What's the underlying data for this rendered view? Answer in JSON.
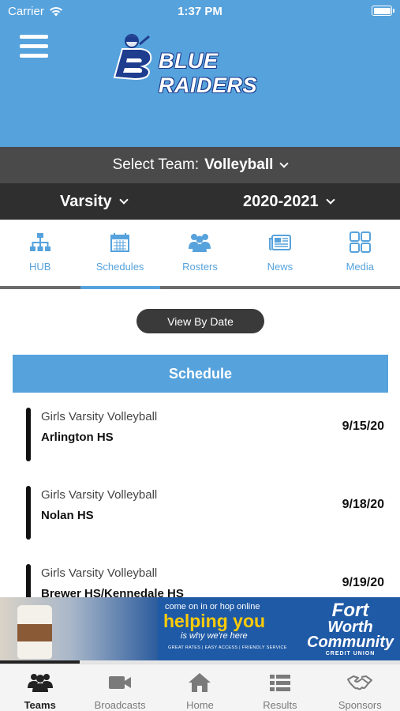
{
  "status_bar": {
    "carrier": "Carrier",
    "time": "1:37 PM"
  },
  "header": {
    "brand": "BLUE RAIDERS"
  },
  "team_selector": {
    "label": "Select Team:",
    "value": "Volleyball"
  },
  "level": {
    "value": "Varsity"
  },
  "season": {
    "value": "2020-2021"
  },
  "tabs": [
    {
      "label": "HUB",
      "icon": "org-chart-icon"
    },
    {
      "label": "Schedules",
      "icon": "calendar-icon",
      "active": true
    },
    {
      "label": "Rosters",
      "icon": "people-icon"
    },
    {
      "label": "News",
      "icon": "newspaper-icon"
    },
    {
      "label": "Media",
      "icon": "grid-icon"
    }
  ],
  "view_button": "View By Date",
  "schedule": {
    "title": "Schedule",
    "games": [
      {
        "sport": "Girls Varsity Volleyball",
        "opponent": "Arlington HS",
        "date": "9/15/20"
      },
      {
        "sport": "Girls Varsity Volleyball",
        "opponent": "Nolan HS",
        "date": "9/18/20"
      },
      {
        "sport": "Girls Varsity Volleyball",
        "opponent": "Brewer HS/Kennedale HS",
        "date": "9/19/20"
      }
    ]
  },
  "ad": {
    "line1": "come on in or hop online",
    "line2": "helping you",
    "line3": "is why we're here",
    "line4": "GREAT RATES | EASY ACCESS | FRIENDLY SERVICE",
    "brand1": "Fort",
    "brand2": "Worth",
    "brand3": "Community",
    "brand4": "CREDIT UNION",
    "progress": 0.2
  },
  "bottom_nav": [
    {
      "label": "Teams",
      "icon": "teams-icon",
      "active": true
    },
    {
      "label": "Broadcasts",
      "icon": "video-camera-icon"
    },
    {
      "label": "Home",
      "icon": "home-icon"
    },
    {
      "label": "Results",
      "icon": "list-icon"
    },
    {
      "label": "Sponsors",
      "icon": "handshake-icon"
    }
  ],
  "colors": {
    "accent": "#56a2dc",
    "dark": "#2f2f2f",
    "mid": "#4a4a4a"
  }
}
